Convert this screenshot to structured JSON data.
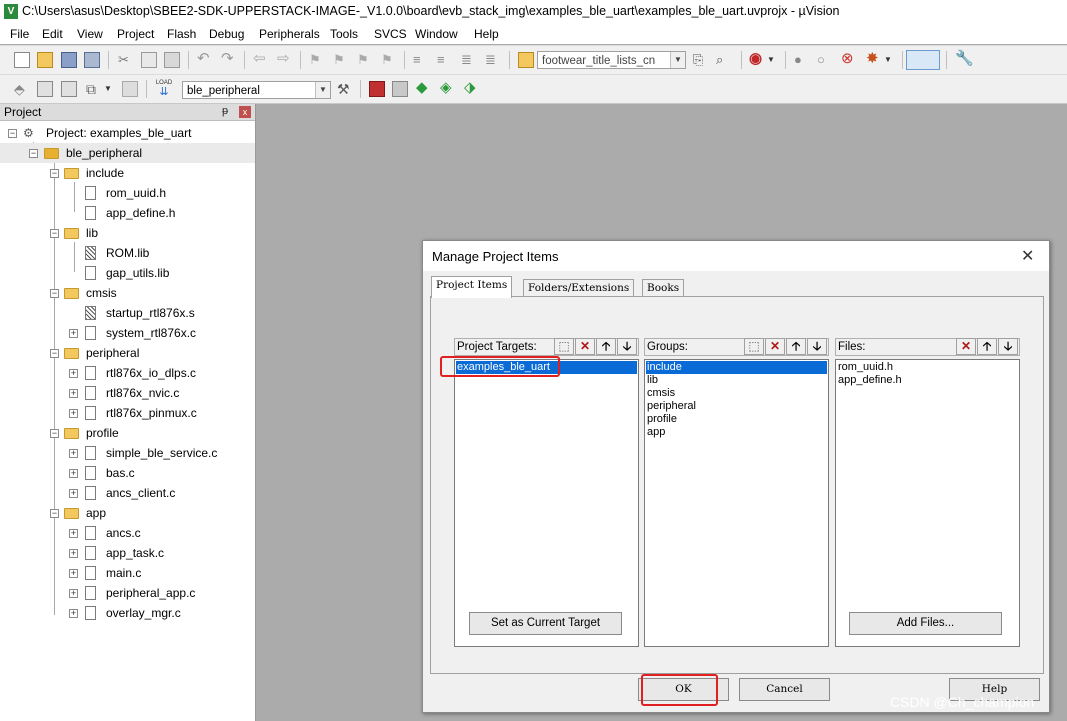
{
  "window": {
    "title": "C:\\Users\\asus\\Desktop\\SBEE2-SDK-UPPERSTACK-IMAGE-_V1.0.0\\board\\evb_stack_img\\examples_ble_uart\\examples_ble_uart.uvprojx - µVision",
    "logo_letter": "V"
  },
  "menu": [
    "File",
    "Edit",
    "View",
    "Project",
    "Flash",
    "Debug",
    "Peripherals",
    "Tools",
    "SVCS",
    "Window",
    "Help"
  ],
  "toolbar": {
    "find_combo_value": "footwear_title_lists_cn",
    "target_combo_value": "ble_peripheral",
    "load_label": "LOAD"
  },
  "project_panel": {
    "title": "Project",
    "pin_glyph": "ᵽ",
    "close_glyph": "x",
    "tree": [
      {
        "label": "Project: examples_ble_uart",
        "type": "project"
      },
      {
        "label": "ble_peripheral",
        "type": "group"
      },
      {
        "label": "include",
        "type": "folder"
      },
      {
        "label": "rom_uuid.h",
        "type": "file"
      },
      {
        "label": "app_define.h",
        "type": "file"
      },
      {
        "label": "lib",
        "type": "folder"
      },
      {
        "label": "ROM.lib",
        "type": "lib"
      },
      {
        "label": "gap_utils.lib",
        "type": "file"
      },
      {
        "label": "cmsis",
        "type": "folder"
      },
      {
        "label": "startup_rtl876x.s",
        "type": "lib"
      },
      {
        "label": "system_rtl876x.c",
        "type": "file"
      },
      {
        "label": "peripheral",
        "type": "folder"
      },
      {
        "label": "rtl876x_io_dlps.c",
        "type": "file"
      },
      {
        "label": "rtl876x_nvic.c",
        "type": "file"
      },
      {
        "label": "rtl876x_pinmux.c",
        "type": "file"
      },
      {
        "label": "profile",
        "type": "folder"
      },
      {
        "label": "simple_ble_service.c",
        "type": "file"
      },
      {
        "label": "bas.c",
        "type": "file"
      },
      {
        "label": "ancs_client.c",
        "type": "file"
      },
      {
        "label": "app",
        "type": "folder"
      },
      {
        "label": "ancs.c",
        "type": "file"
      },
      {
        "label": "app_task.c",
        "type": "file"
      },
      {
        "label": "main.c",
        "type": "file"
      },
      {
        "label": "peripheral_app.c",
        "type": "file"
      },
      {
        "label": "overlay_mgr.c",
        "type": "file"
      }
    ]
  },
  "dialog": {
    "title": "Manage Project Items",
    "close_glyph": "✕",
    "tabs": [
      "Project Items",
      "Folders/Extensions",
      "Books"
    ],
    "targets_label": "Project Targets:",
    "targets": [
      "examples_ble_uart"
    ],
    "groups_label": "Groups:",
    "groups": [
      "include",
      "lib",
      "cmsis",
      "peripheral",
      "profile",
      "app"
    ],
    "files_label": "Files:",
    "files": [
      "rom_uuid.h",
      "app_define.h"
    ],
    "set_target_button": "Set as Current Target",
    "add_files_button": "Add Files...",
    "ok_button": "OK",
    "cancel_button": "Cancel",
    "help_button": "Help",
    "glyphs": {
      "new": "⬚",
      "delete": "✕",
      "up": "🡡",
      "down": "🡣"
    }
  },
  "watermark": "CSDN @Ch_champion",
  "colors": {
    "selection": "#0a6bd6",
    "highlight_box": "#e02020",
    "workspace": "#ababab"
  }
}
